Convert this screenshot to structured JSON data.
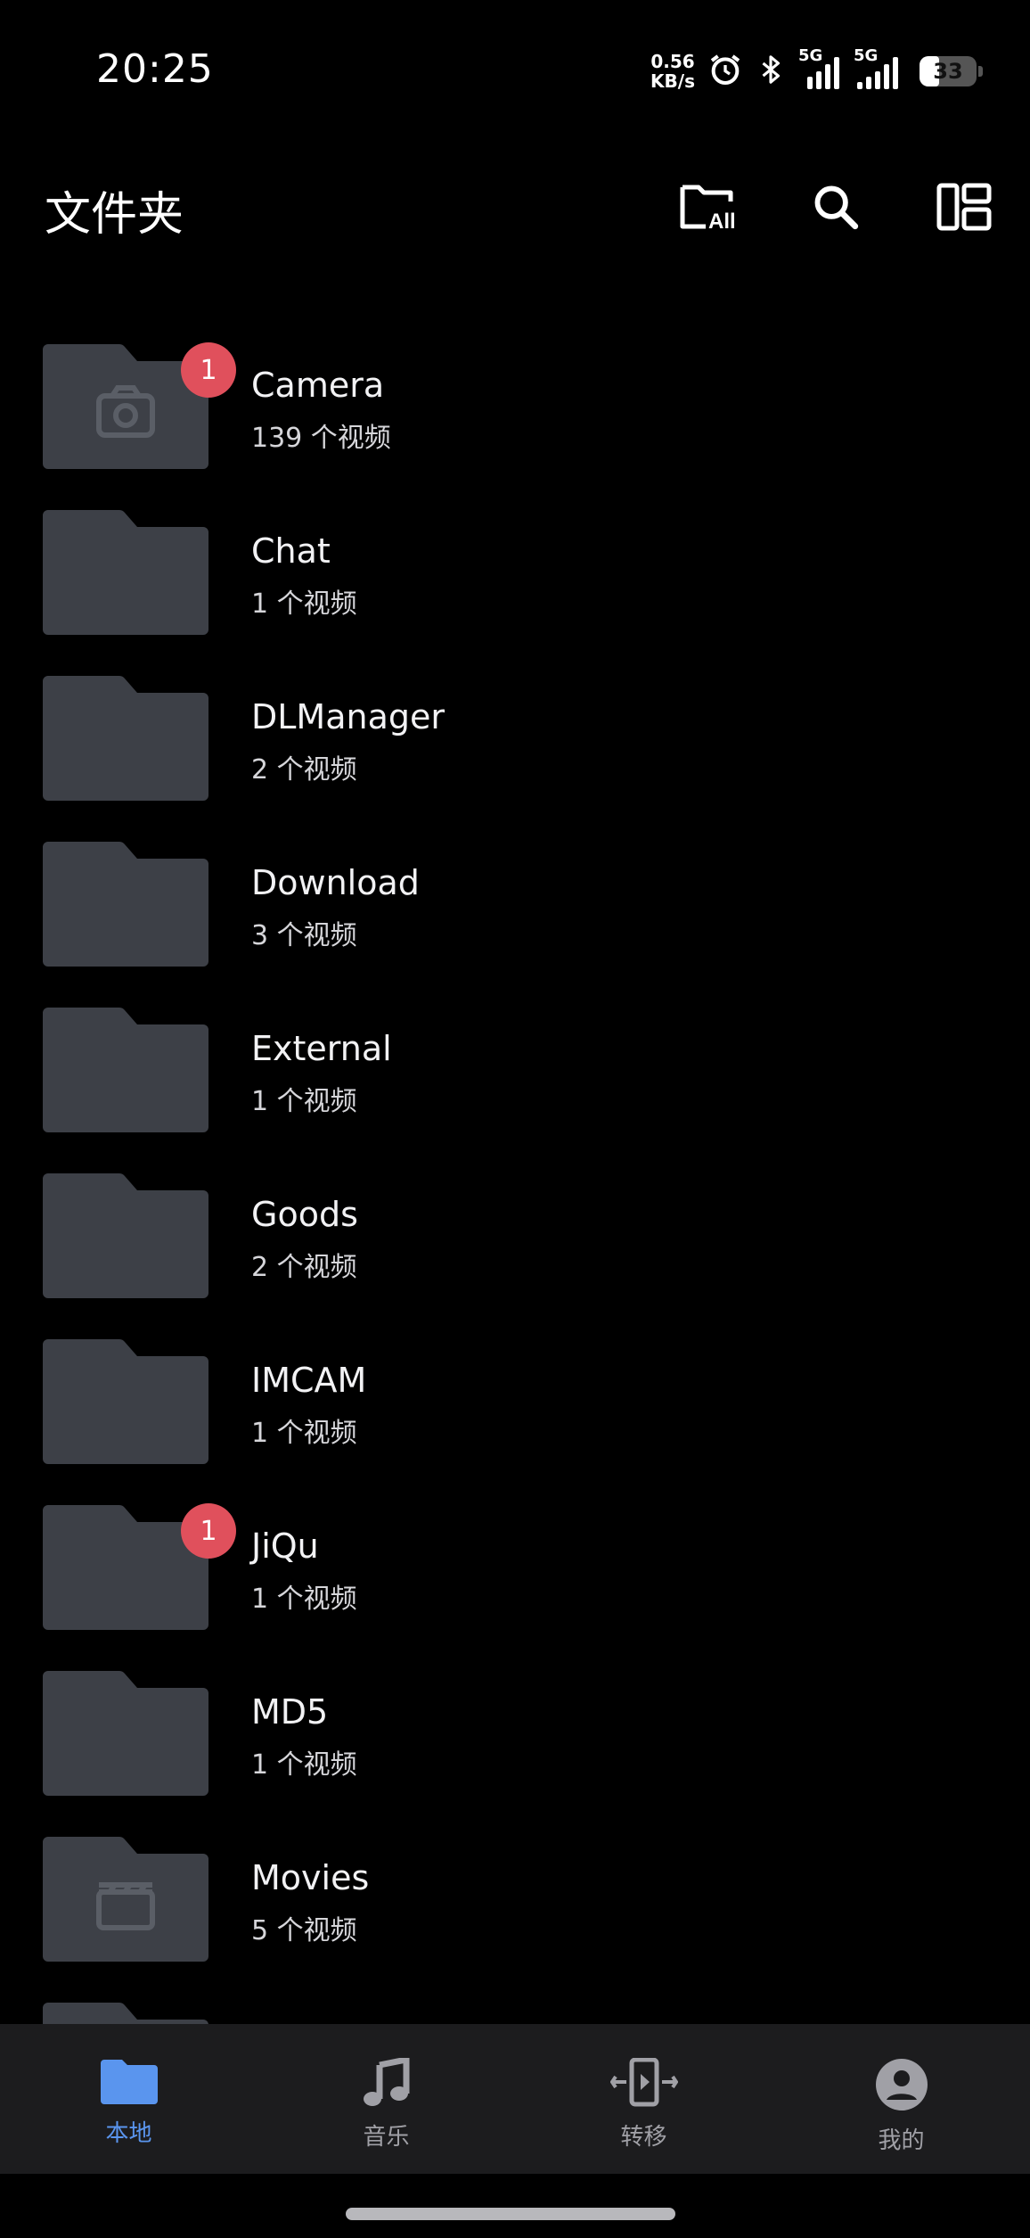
{
  "status_bar": {
    "time": "20:25",
    "net_speed_value": "0.56",
    "net_speed_unit": "KB/s",
    "signal1_label": "5G",
    "signal2_label": "5G",
    "battery_level": "33"
  },
  "header": {
    "title": "文件夹",
    "icons": [
      "folder-all-icon",
      "search-icon",
      "layout-toggle-icon"
    ]
  },
  "folders": [
    {
      "name": "Camera",
      "count": "139 个视频",
      "badge": "1",
      "icon": "camera-icon"
    },
    {
      "name": "Chat",
      "count": "1 个视频"
    },
    {
      "name": "DLManager",
      "count": "2 个视频"
    },
    {
      "name": "Download",
      "count": "3 个视频"
    },
    {
      "name": "External",
      "count": "1 个视频"
    },
    {
      "name": "Goods",
      "count": "2 个视频"
    },
    {
      "name": "IMCAM",
      "count": "1 个视频"
    },
    {
      "name": "JiQu",
      "count": "1 个视频",
      "badge": "1"
    },
    {
      "name": "MD5",
      "count": "1 个视频"
    },
    {
      "name": "Movies",
      "count": "5 个视频",
      "icon": "clapperboard-icon"
    }
  ],
  "bottom_nav": {
    "items": [
      {
        "label": "本地",
        "icon": "folder-icon",
        "active": true
      },
      {
        "label": "音乐",
        "icon": "music-note-icon",
        "active": false
      },
      {
        "label": "转移",
        "icon": "transfer-icon",
        "active": false
      },
      {
        "label": "我的",
        "icon": "profile-icon",
        "active": false
      }
    ]
  },
  "colors": {
    "background": "#000000",
    "folder": "#3d4047",
    "badge": "#e0505c",
    "accent": "#5a95ee",
    "nav_bg": "#1c1c1e"
  }
}
